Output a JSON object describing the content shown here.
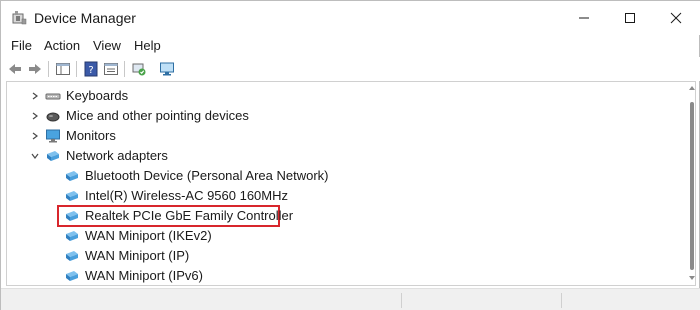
{
  "window": {
    "title": "Device Manager"
  },
  "menu": {
    "items": [
      "File",
      "Action",
      "View",
      "Help"
    ]
  },
  "toolbar": {
    "buttons": [
      "back-arrow-icon",
      "forward-arrow-icon",
      "show-hide-console-tree-icon",
      "help-icon",
      "properties-icon",
      "scan-hardware-icon",
      "monitor-icon"
    ]
  },
  "tree": {
    "rows": [
      {
        "label": "Keyboards",
        "level": 1,
        "expanded": false,
        "icon": "keyboard-icon"
      },
      {
        "label": "Mice and other pointing devices",
        "level": 1,
        "expanded": false,
        "icon": "mouse-icon"
      },
      {
        "label": "Monitors",
        "level": 1,
        "expanded": false,
        "icon": "monitor-icon"
      },
      {
        "label": "Network adapters",
        "level": 1,
        "expanded": true,
        "icon": "network-adapter-icon"
      },
      {
        "label": "Bluetooth Device (Personal Area Network)",
        "level": 2,
        "icon": "network-adapter-icon"
      },
      {
        "label": "Intel(R) Wireless-AC 9560 160MHz",
        "level": 2,
        "icon": "network-adapter-icon"
      },
      {
        "label": "Realtek PCIe GbE Family Controller",
        "level": 2,
        "icon": "network-adapter-icon",
        "highlighted": true
      },
      {
        "label": "WAN Miniport (IKEv2)",
        "level": 2,
        "icon": "network-adapter-icon"
      },
      {
        "label": "WAN Miniport (IP)",
        "level": 2,
        "icon": "network-adapter-icon"
      },
      {
        "label": "WAN Miniport (IPv6)",
        "level": 2,
        "icon": "network-adapter-icon"
      }
    ]
  },
  "colors": {
    "highlight_border": "#d8262c",
    "adapter_blue": "#3a8fd0"
  }
}
